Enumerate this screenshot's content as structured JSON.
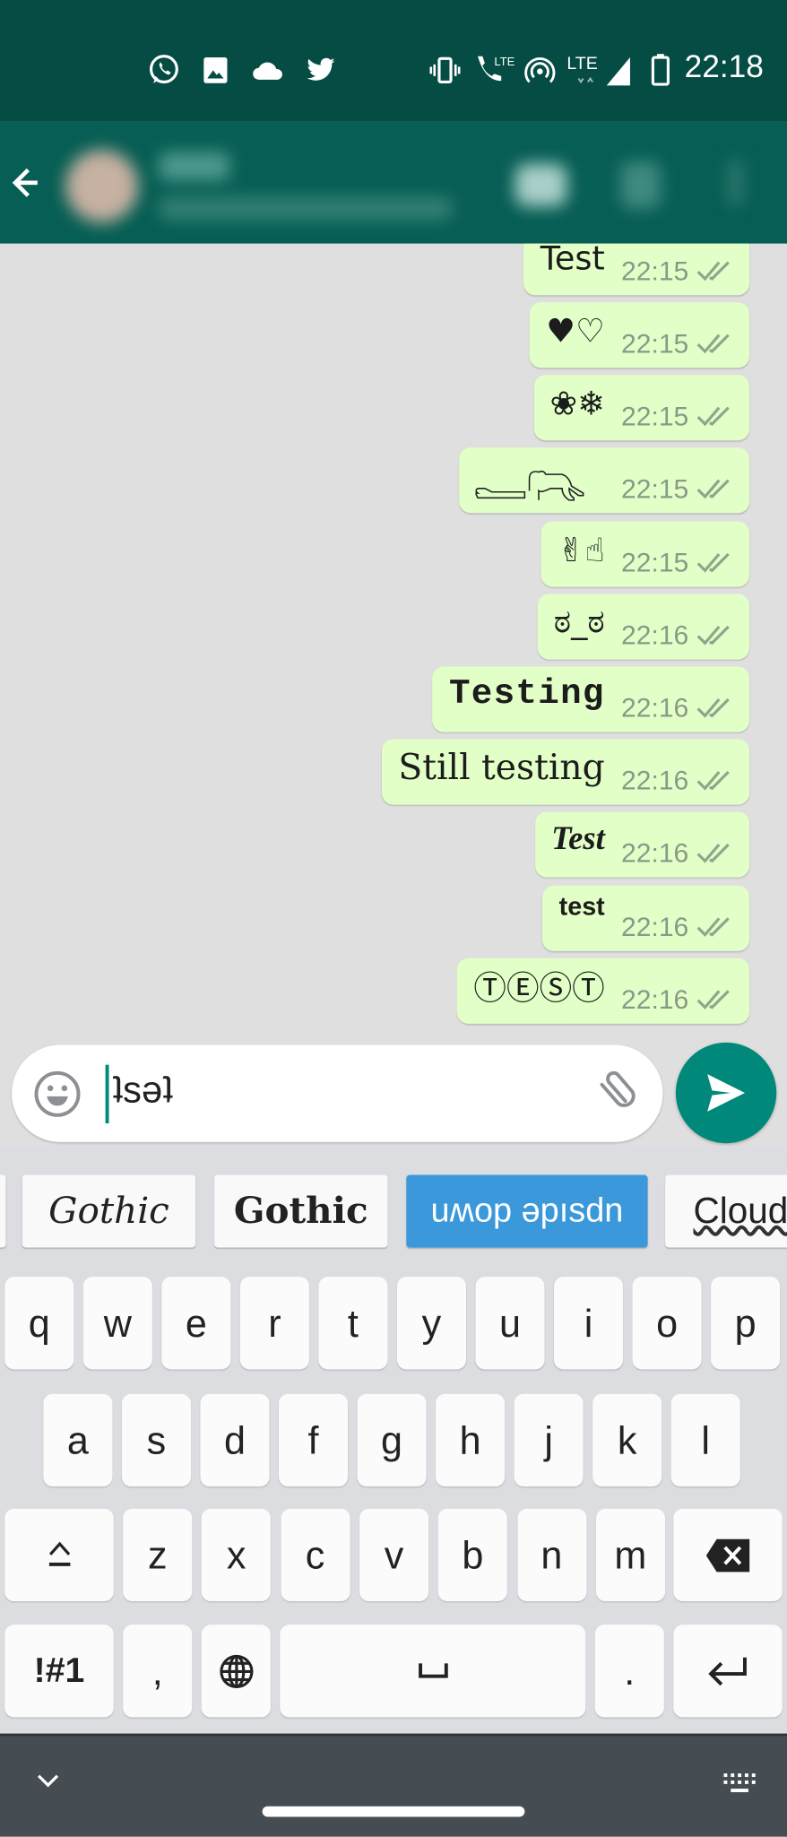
{
  "status_bar": {
    "time": "22:18",
    "left_icons": [
      "whatsapp-icon",
      "gallery-icon",
      "cloud-icon",
      "twitter-icon"
    ],
    "right_icons": [
      "vibrate-icon",
      "volte-call-icon",
      "hotspot-icon",
      "lte-signal-icon",
      "battery-icon"
    ],
    "lte_label": "LTE"
  },
  "app_bar": {
    "back_icon": "arrow-back-icon",
    "contact_blurred": true
  },
  "messages": [
    {
      "text": "Test",
      "time": "22:15",
      "style": "plain"
    },
    {
      "text": "♥♡",
      "time": "22:15",
      "style": "plain"
    },
    {
      "text": "❀❄",
      "time": "22:15",
      "style": "plain"
    },
    {
      "text": "",
      "icon": "figure-drawing-icon",
      "time": "22:15",
      "style": "figure"
    },
    {
      "text": "✌☝",
      "time": "22:15",
      "style": "plain"
    },
    {
      "text": "ಠ_ಠ",
      "time": "22:16",
      "style": "plain"
    },
    {
      "text": "Testing",
      "time": "22:16",
      "style": "mono"
    },
    {
      "text": "Still testing",
      "time": "22:16",
      "style": "outline"
    },
    {
      "text": "Test",
      "time": "22:16",
      "style": "script"
    },
    {
      "text": "test",
      "time": "22:16",
      "style": "bold-small"
    },
    {
      "text": "ⓉⒺⓈⓉ",
      "time": "22:16",
      "style": "plain"
    }
  ],
  "composer": {
    "value": "ʇsǝʇ",
    "emoji_icon": "emoji-icon",
    "attach_icon": "paperclip-icon",
    "send_icon": "send-icon"
  },
  "font_suggestions": [
    {
      "label": "Gothic",
      "style": "gothic-light",
      "selected": false
    },
    {
      "label": "Gothic",
      "style": "gothic-bold",
      "selected": false
    },
    {
      "label": "uʍop ǝpısdn",
      "style": "upside-down",
      "selected": true
    },
    {
      "label": "Cloud",
      "style": "cloud",
      "selected": false
    }
  ],
  "colors": {
    "accent": "#00897b",
    "header": "#075e54",
    "status": "#054c44",
    "bubble": "#e1ffc7",
    "selected_chip": "#3a98db"
  },
  "keyboard": {
    "row1": [
      "q",
      "w",
      "e",
      "r",
      "t",
      "y",
      "u",
      "i",
      "o",
      "p"
    ],
    "row2": [
      "a",
      "s",
      "d",
      "f",
      "g",
      "h",
      "j",
      "k",
      "l"
    ],
    "row3": [
      "z",
      "x",
      "c",
      "v",
      "b",
      "n",
      "m"
    ],
    "symbols_label": "!#1",
    "comma": ",",
    "period": ".",
    "space_label": "␣"
  }
}
